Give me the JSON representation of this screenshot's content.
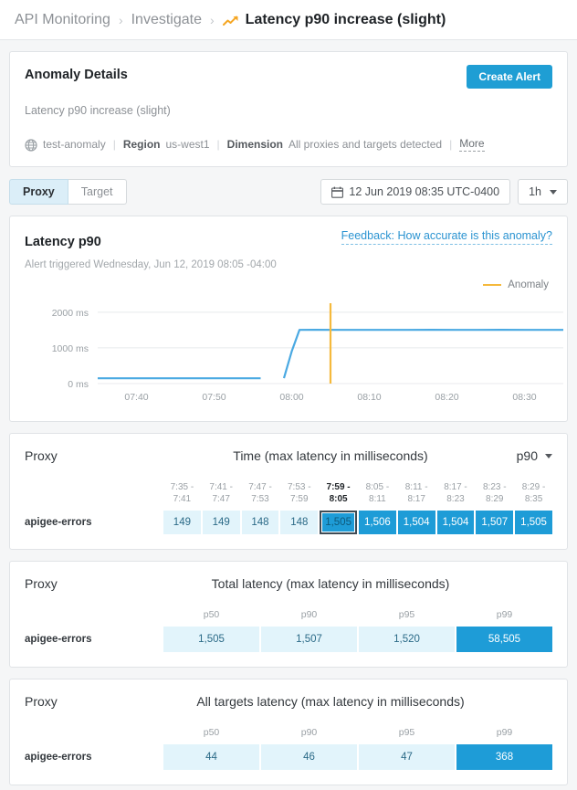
{
  "breadcrumb": {
    "items": [
      "API Monitoring",
      "Investigate"
    ],
    "separator": "›",
    "current": "Latency p90 increase (slight)",
    "current_icon": "trending-up-icon"
  },
  "anomaly": {
    "title": "Anomaly Details",
    "create_alert_label": "Create Alert",
    "subtitle": "Latency p90 increase (slight)",
    "org_icon": "globe-icon",
    "org": "test-anomaly",
    "region_key": "Region",
    "region_value": "us-west1",
    "dimension_key": "Dimension",
    "dimension_value": "All proxies and targets detected",
    "more_label": "More"
  },
  "controls": {
    "segments": [
      {
        "label": "Proxy",
        "active": true
      },
      {
        "label": "Target",
        "active": false
      }
    ],
    "date_icon": "calendar-icon",
    "date_value": "12 Jun 2019 08:35 UTC-0400",
    "range_value": "1h"
  },
  "chart_card": {
    "title": "Latency p90",
    "feedback_link": "Feedback: How accurate is this anomaly?",
    "alert_triggered": "Alert triggered Wednesday, Jun 12, 2019 08:05 -04:00"
  },
  "chart_data": {
    "type": "line",
    "title": "Latency p90",
    "xlabel": "",
    "ylabel": "",
    "ylim": [
      0,
      2200
    ],
    "yticks": [
      0,
      1000,
      2000
    ],
    "ytick_labels": [
      "0 ms",
      "1000 ms",
      "2000 ms"
    ],
    "xticks": [
      "07:40",
      "07:50",
      "08:00",
      "08:10",
      "08:20",
      "08:30"
    ],
    "xlim": [
      "07:35",
      "08:35"
    ],
    "grid": true,
    "legend": [
      {
        "name": "Anomaly",
        "color": "#f5b93c",
        "style": "line"
      }
    ],
    "series": [
      {
        "name": "Latency p90",
        "color": "#4aa9e2",
        "x": [
          "07:35",
          "07:38",
          "07:41",
          "07:44",
          "07:47",
          "07:50",
          "07:53",
          "07:56",
          "07:57",
          "07:59",
          "08:00",
          "08:01",
          "08:03",
          "08:06",
          "08:09",
          "08:12",
          "08:15",
          "08:18",
          "08:21",
          "08:24",
          "08:27",
          "08:30",
          "08:33",
          "08:35"
        ],
        "y": [
          149,
          149,
          149,
          148,
          148,
          148,
          148,
          148,
          149,
          150,
          900,
          1505,
          1506,
          1505,
          1504,
          1504,
          1505,
          1507,
          1505,
          1505,
          1506,
          1505,
          1505,
          1505
        ]
      }
    ],
    "annotations": [
      {
        "type": "vline",
        "x": "08:05",
        "color": "#f5b93c",
        "label": "Anomaly"
      }
    ],
    "gaps": [
      {
        "start": "07:36.5",
        "end": "07:37.5"
      },
      {
        "start": "07:39.5",
        "end": "07:40.5"
      },
      {
        "start": "07:45.5",
        "end": "07:46.5"
      },
      {
        "start": "07:56.2",
        "end": "07:57.2"
      },
      {
        "start": "08:19.5",
        "end": "08:21.0"
      }
    ]
  },
  "time_table": {
    "proxy_label": "Proxy",
    "title": "Time (max latency in milliseconds)",
    "percentile_selector": "p90",
    "columns": [
      {
        "line1": "7:35 -",
        "line2": "7:41",
        "highlight": false
      },
      {
        "line1": "7:41 -",
        "line2": "7:47",
        "highlight": false
      },
      {
        "line1": "7:47 -",
        "line2": "7:53",
        "highlight": false
      },
      {
        "line1": "7:53 -",
        "line2": "7:59",
        "highlight": false
      },
      {
        "line1": "7:59 -",
        "line2": "8:05",
        "highlight": true
      },
      {
        "line1": "8:05 -",
        "line2": "8:11",
        "highlight": false
      },
      {
        "line1": "8:11 -",
        "line2": "8:17",
        "highlight": false
      },
      {
        "line1": "8:17 -",
        "line2": "8:23",
        "highlight": false
      },
      {
        "line1": "8:23 -",
        "line2": "8:29",
        "highlight": false
      },
      {
        "line1": "8:29 -",
        "line2": "8:35",
        "highlight": false
      }
    ],
    "rows": [
      {
        "label": "apigee-errors",
        "cells": [
          {
            "value": "149",
            "level": "low",
            "selected": false
          },
          {
            "value": "149",
            "level": "low",
            "selected": false
          },
          {
            "value": "148",
            "level": "low",
            "selected": false
          },
          {
            "value": "148",
            "level": "low",
            "selected": false
          },
          {
            "value": "1,505",
            "level": "high",
            "selected": true
          },
          {
            "value": "1,506",
            "level": "high",
            "selected": false
          },
          {
            "value": "1,504",
            "level": "high",
            "selected": false
          },
          {
            "value": "1,504",
            "level": "high",
            "selected": false
          },
          {
            "value": "1,507",
            "level": "high",
            "selected": false
          },
          {
            "value": "1,505",
            "level": "high",
            "selected": false
          }
        ]
      }
    ]
  },
  "total_latency_table": {
    "proxy_label": "Proxy",
    "title": "Total latency (max latency in milliseconds)",
    "columns": [
      "p50",
      "p90",
      "p95",
      "p99"
    ],
    "rows": [
      {
        "label": "apigee-errors",
        "cells": [
          {
            "value": "1,505",
            "level": "low"
          },
          {
            "value": "1,507",
            "level": "low"
          },
          {
            "value": "1,520",
            "level": "low"
          },
          {
            "value": "58,505",
            "level": "high"
          }
        ]
      }
    ]
  },
  "targets_latency_table": {
    "proxy_label": "Proxy",
    "title": "All targets latency (max latency in milliseconds)",
    "columns": [
      "p50",
      "p90",
      "p95",
      "p99"
    ],
    "rows": [
      {
        "label": "apigee-errors",
        "cells": [
          {
            "value": "44",
            "level": "low"
          },
          {
            "value": "46",
            "level": "low"
          },
          {
            "value": "47",
            "level": "low"
          },
          {
            "value": "368",
            "level": "high"
          }
        ]
      }
    ]
  },
  "colors": {
    "accent_blue": "#1f9ed4",
    "heat_low": "#e2f4fb",
    "heat_high": "#1e9cd7",
    "anomaly_orange": "#f5b93c",
    "line_blue": "#4aa9e2"
  }
}
